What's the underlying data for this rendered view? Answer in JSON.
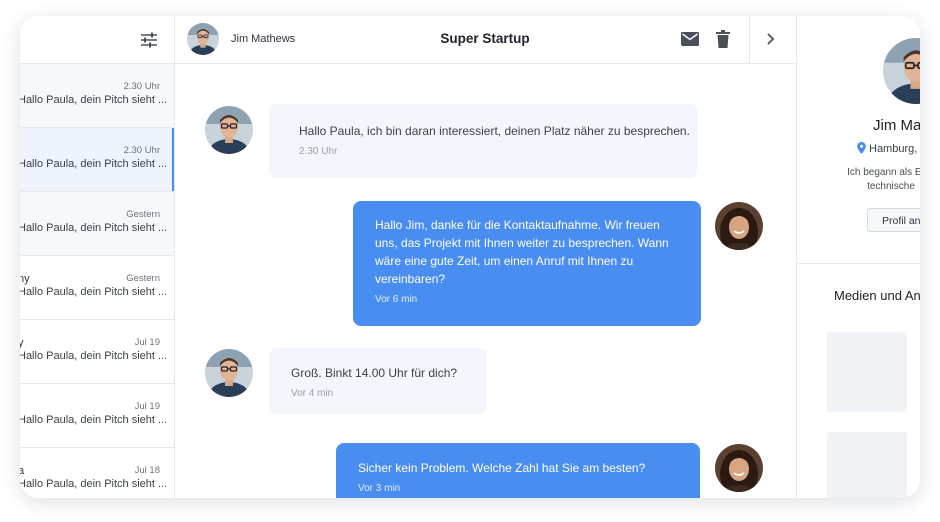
{
  "list": {
    "conversations": [
      {
        "name": "",
        "time": "2.30 Uhr",
        "preview": "Hallo Paula, dein Pitch sieht ..."
      },
      {
        "name": "",
        "time": "2.30 Uhr",
        "preview": "Hallo Paula, dein Pitch sieht ..."
      },
      {
        "name": "",
        "time": "Gestern",
        "preview": "Hallo Paula, dein Pitch sieht ..."
      },
      {
        "name": "ny",
        "time": "Gestern",
        "preview": "Hallo Paula, dein Pitch sieht ..."
      },
      {
        "name": "y",
        "time": "Jul 19",
        "preview": "Hallo Paula, dein Pitch sieht ..."
      },
      {
        "name": "",
        "time": "Jul 19",
        "preview": "Hallo Paula, dein Pitch sieht ..."
      },
      {
        "name": "a",
        "time": "Jul 18",
        "preview": "Hallo Paula, dein Pitch sieht ..."
      }
    ]
  },
  "chat": {
    "contact_name": "Jim Mathews",
    "title": "Super Startup",
    "messages": [
      {
        "direction": "in",
        "text": "Hallo Paula, ich bin daran interessiert, deinen Platz näher zu besprechen.",
        "time": "2.30 Uhr"
      },
      {
        "direction": "out",
        "text": "Hallo Jim, danke für die Kontaktaufnahme. Wir freuen uns, das Projekt mit Ihnen weiter zu besprechen. Wann wäre eine gute Zeit, um einen Anruf mit Ihnen zu vereinbaren?",
        "time": "Vor 6 min"
      },
      {
        "direction": "in",
        "text": "Groß. Binkt 14.00 Uhr für dich?",
        "time": "Vor 4 min"
      },
      {
        "direction": "out",
        "text": "Sicher kein Problem. Welche Zahl hat Sie am besten?",
        "time": "Vor 3 min"
      }
    ]
  },
  "profile": {
    "name": "Jim Ma",
    "location": "Hamburg,",
    "bio_line1": "Ich begann als Entv",
    "bio_line2": "technische",
    "button_label": "Profil an",
    "media_title": "Medien und An"
  },
  "colors": {
    "accent": "#4a8df0",
    "incoming_bubble": "#f3f6fa"
  }
}
